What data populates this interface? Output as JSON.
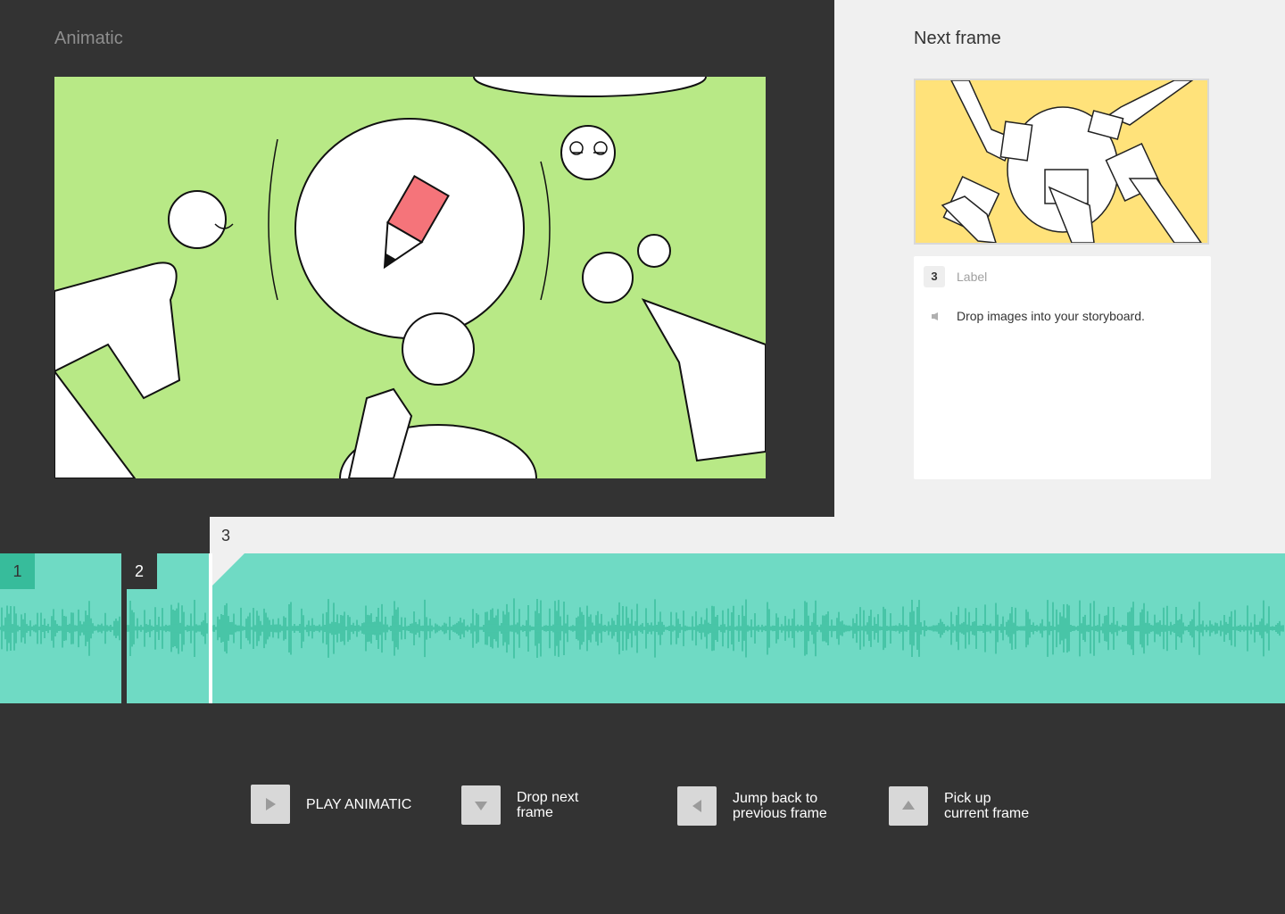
{
  "animatic": {
    "title": "Animatic",
    "current_frame_image": "storyboard-sketch-kids-around-pencil-circle"
  },
  "next_frame": {
    "title": "Next frame",
    "thumbnail_image": "storyboard-sketch-hands-placing-cards",
    "card": {
      "number": "3",
      "label_placeholder": "Label",
      "sound_icon": "speaker-icon",
      "description": "Drop images into your storyboard."
    }
  },
  "timeline": {
    "frames": [
      {
        "number": "1"
      },
      {
        "number": "2"
      },
      {
        "number": "3"
      }
    ]
  },
  "controls": [
    {
      "icon": "play-icon",
      "label": "PLAY ANIMATIC"
    },
    {
      "icon": "arrow-down-icon",
      "label": "Drop next\nframe"
    },
    {
      "icon": "arrow-left-icon",
      "label": "Jump back to\nprevious frame"
    },
    {
      "icon": "arrow-up-icon",
      "label": "Pick up\ncurrent frame"
    }
  ],
  "colors": {
    "background_dark": "#333333",
    "panel_light": "#f0f0f0",
    "frame_green": "#b8e986",
    "thumb_yellow": "#ffe27a",
    "track_teal": "#6fdac4",
    "wave_teal": "#37bc9b"
  }
}
